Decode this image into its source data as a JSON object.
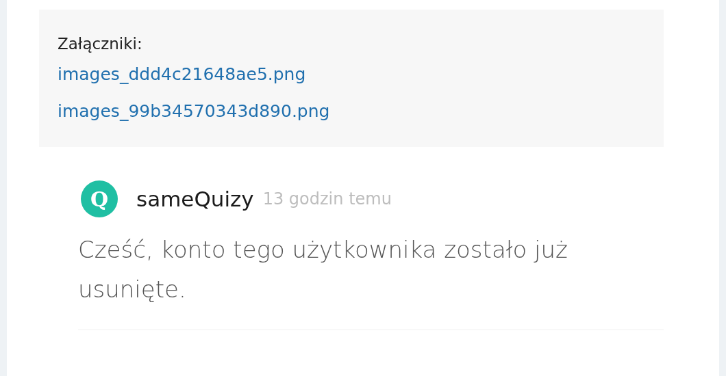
{
  "attachments": {
    "label": "Załączniki:",
    "files": [
      "images_ddd4c21648ae5.png",
      "images_99b34570343d890.png"
    ]
  },
  "comment": {
    "avatar_letter": "Q",
    "author": "sameQuizy",
    "time": "13 godzin temu",
    "text": "Cześć, konto tego użytkownika zostało już usunięte."
  }
}
